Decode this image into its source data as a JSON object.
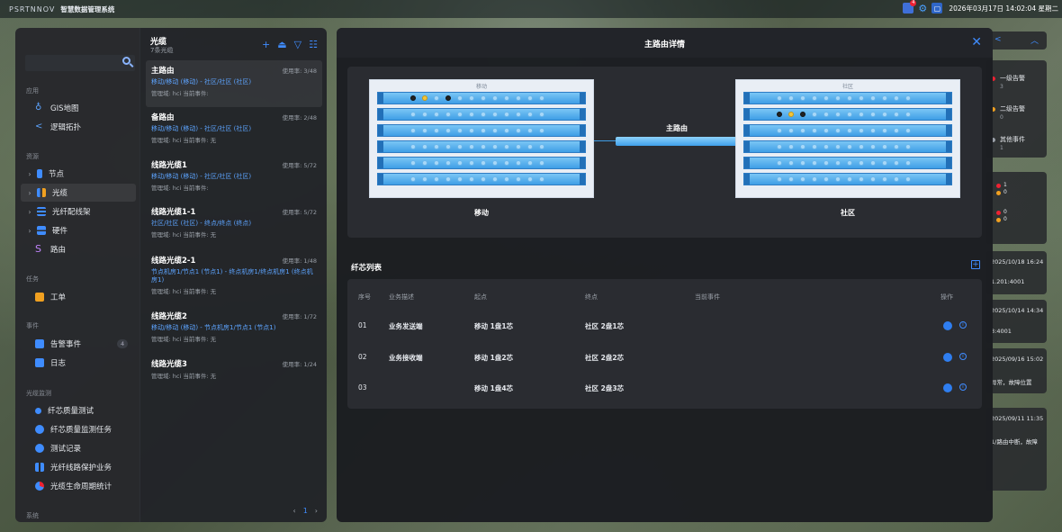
{
  "app": {
    "logo": "PSRTNNOV",
    "system_title": "智慧数据管理系统",
    "datetime": "2026年03月17日 14:02:04 星期二",
    "notification_count": "4"
  },
  "sidebar": {
    "search_placeholder": "",
    "sections": {
      "app": "应用",
      "resource": "资源",
      "task": "任务",
      "event": "事件",
      "monitor": "光缆监测",
      "system": "系统"
    },
    "items": [
      {
        "label": "GIS地图"
      },
      {
        "label": "逻辑拓扑"
      },
      {
        "label": "节点"
      },
      {
        "label": "光缆"
      },
      {
        "label": "光纤配线架"
      },
      {
        "label": "硬件"
      },
      {
        "label": "路由"
      },
      {
        "label": "工单"
      },
      {
        "label": "告警事件",
        "badge": "4"
      },
      {
        "label": "日志"
      },
      {
        "label": "纤芯质量测试"
      },
      {
        "label": "纤芯质量监测任务"
      },
      {
        "label": "测试记录"
      },
      {
        "label": "光纤线路保护业务"
      },
      {
        "label": "光缆生命周期统计"
      }
    ]
  },
  "cable_list": {
    "title": "光缆",
    "subtitle": "7条光缆",
    "items": [
      {
        "name": "主路由",
        "usage": "使用率: 3/48",
        "route": "移动/移动 (移动) - 社区/社区 (社区)",
        "meta": "管理域: hci   当前事件:"
      },
      {
        "name": "备路由",
        "usage": "使用率: 2/48",
        "route": "移动/移动 (移动) - 社区/社区 (社区)",
        "meta": "管理域: hci   当前事件: 无"
      },
      {
        "name": "线路光缆1",
        "usage": "使用率: 5/72",
        "route": "移动/移动 (移动) - 社区/社区 (社区)",
        "meta": "管理域: hci   当前事件:"
      },
      {
        "name": "线路光缆1-1",
        "usage": "使用率: 5/72",
        "route": "社区/社区 (社区) - 终点/终点 (终点)",
        "meta": "管理域: hci   当前事件: 无"
      },
      {
        "name": "线路光缆2-1",
        "usage": "使用率: 1/48",
        "route": "节点机房1/节点1 (节点1) - 终点机房1/终点机房1 (终点机房1)",
        "meta": "管理域: hci   当前事件: 无"
      },
      {
        "name": "线路光缆2",
        "usage": "使用率: 1/72",
        "route": "移动/移动 (移动) - 节点机房1/节点1 (节点1)",
        "meta": "管理域: hci   当前事件: 无"
      },
      {
        "name": "线路光缆3",
        "usage": "使用率: 1/24",
        "route": "",
        "meta": "管理域: hci   当前事件: 无"
      }
    ],
    "page": "1"
  },
  "detail": {
    "title": "主路由详情",
    "left_panel_top": "移动",
    "right_panel_top": "社区",
    "link_label": "主路由",
    "left_name": "移动",
    "right_name": "社区",
    "fiber_header": "纤芯列表",
    "columns": [
      "序号",
      "业务描述",
      "起点",
      "终点",
      "当前事件",
      "操作"
    ],
    "rows": [
      {
        "no": "01",
        "desc": "业务发送端",
        "start": "移动 1盘1芯",
        "end": "社区 2盘1芯",
        "event": ""
      },
      {
        "no": "02",
        "desc": "业务接收端",
        "start": "移动 1盘2芯",
        "end": "社区 2盘2芯",
        "event": ""
      },
      {
        "no": "03",
        "desc": "",
        "start": "移动 1盘4芯",
        "end": "社区 2盘3芯",
        "event": ""
      }
    ]
  },
  "right_panel": {
    "level1": "一级告警",
    "level1_count": "3",
    "level2": "二级告警",
    "level2_count": "0",
    "other": "其他事件",
    "other_count": "1",
    "stats": [
      "1",
      "0",
      "0",
      "0"
    ],
    "events": [
      {
        "time": "2025/10/18 16:24",
        "text": "1.201:4001"
      },
      {
        "time": "2025/10/14 14:34",
        "text": "3:4001"
      },
      {
        "time": "2025/09/16 15:02",
        "text": "异常，故障位置"
      },
      {
        "time": "2025/09/11 11:35",
        "text": "1/路由中断，故障"
      }
    ]
  },
  "colors": {
    "accent": "#3f8cff",
    "panel": "#26282c"
  }
}
